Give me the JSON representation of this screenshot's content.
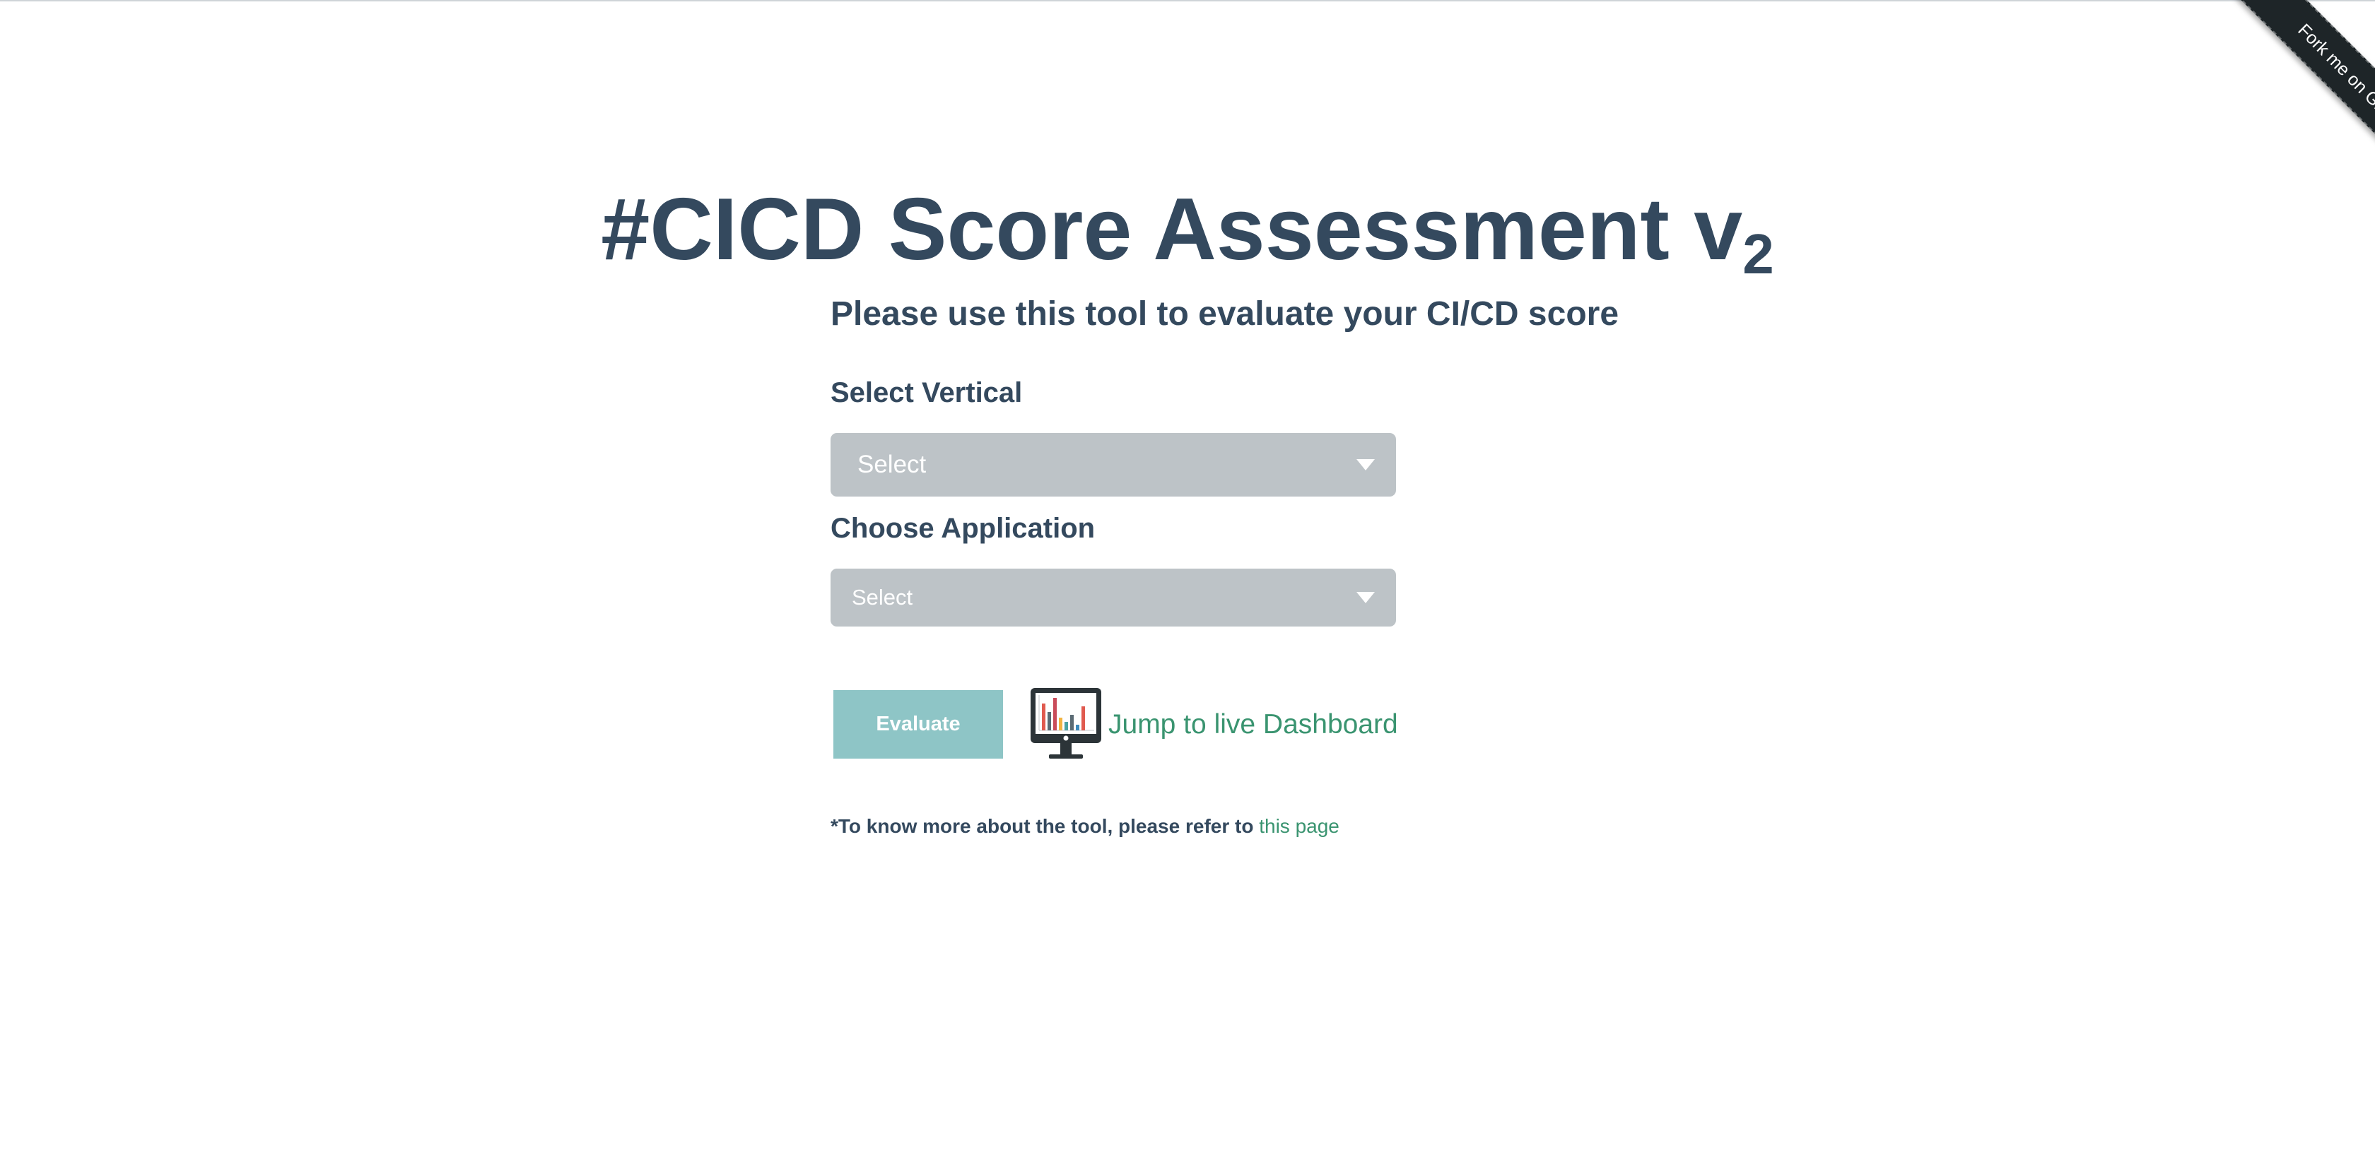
{
  "ribbon": {
    "label": "Fork me on GitHub"
  },
  "header": {
    "title": "#CICD Score Assessment v",
    "title_version": "2",
    "subtitle": "Please use this tool to evaluate your CI/CD score"
  },
  "form": {
    "vertical": {
      "label": "Select Vertical",
      "selected": "Select"
    },
    "application": {
      "label": "Choose Application",
      "selected": "Select"
    },
    "evaluate_label": "Evaluate",
    "dashboard_link_label": "Jump to live Dashboard"
  },
  "footnote": {
    "text": "*To know more about the tool, please refer to",
    "link_label": "this page"
  },
  "colors": {
    "text": "#34495e",
    "select_bg": "#bdc3c7",
    "button_bg": "#8ec5c6",
    "link": "#3a9470",
    "ribbon": "#1e2528"
  }
}
